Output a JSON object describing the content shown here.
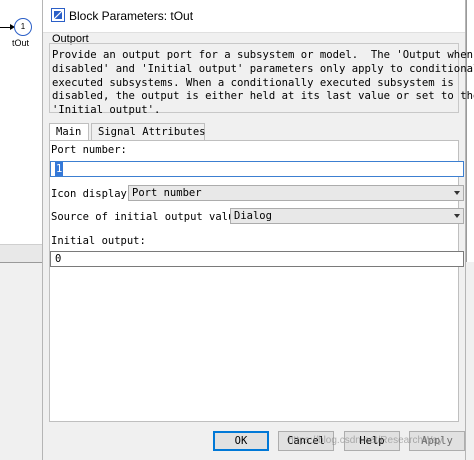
{
  "canvas": {
    "block_number": "1",
    "block_name": "tOut"
  },
  "dialog": {
    "title": "Block Parameters: tOut",
    "group_title": "Outport",
    "description_lines": [
      "Provide an output port for a subsystem or model.  The 'Output when",
      "disabled' and 'Initial output' parameters only apply to conditionally",
      "executed subsystems. When a conditionally executed subsystem is",
      "disabled, the output is either held at its last value or set to the",
      "'Initial output'."
    ],
    "tabs": [
      {
        "label": "Main",
        "active": true
      },
      {
        "label": "Signal Attributes",
        "active": false
      }
    ],
    "fields": {
      "port_number_label": "Port number:",
      "port_number_value": "1",
      "icon_display_label": "Icon display:",
      "icon_display_value": "Port number",
      "source_label": "Source of initial output value:",
      "source_value": "Dialog",
      "initial_output_label": "Initial output:",
      "initial_output_value": "0"
    },
    "buttons": {
      "ok": "OK",
      "cancel": "Cancel",
      "help": "Help",
      "apply": "Apply"
    }
  },
  "watermark": "https://blog.csdn.net/ResearchWay"
}
